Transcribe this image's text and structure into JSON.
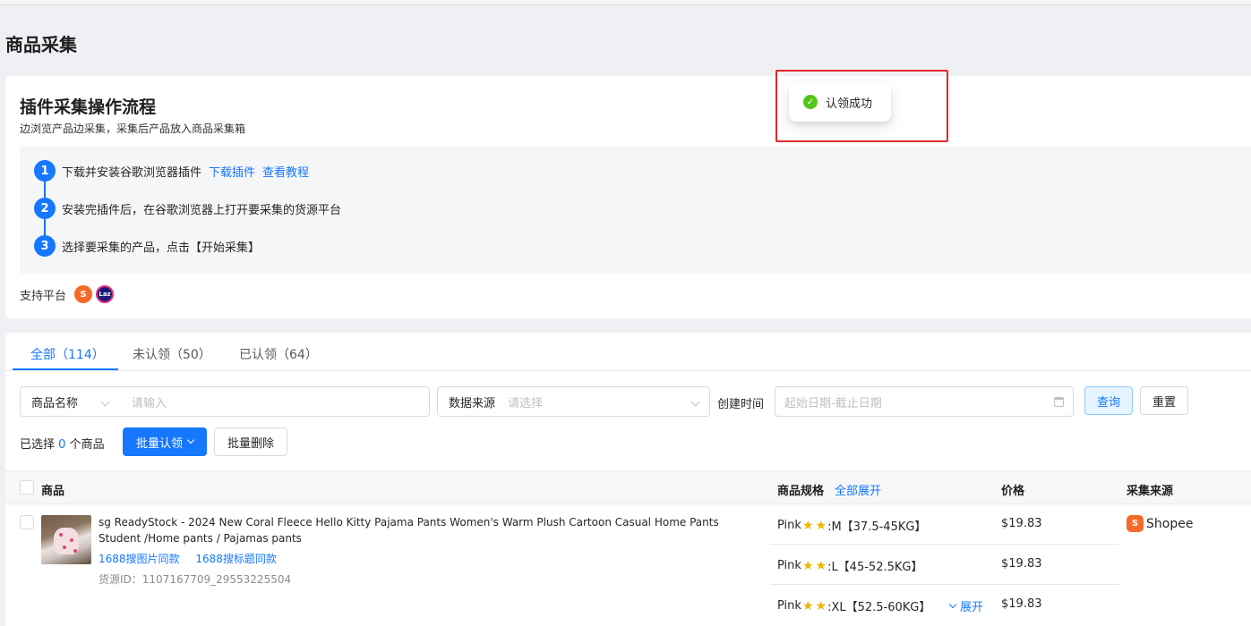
{
  "page": {
    "title": "商品采集"
  },
  "guide": {
    "title": "插件采集操作流程",
    "subtitle": "边浏览产品边采集，采集后产品放入商品采集箱",
    "steps": [
      {
        "num": "1",
        "text": "下载并安装谷歌浏览器插件",
        "links": [
          "下载插件",
          "查看教程"
        ]
      },
      {
        "num": "2",
        "text": "安装完插件后，在谷歌浏览器上打开要采集的货源平台"
      },
      {
        "num": "3",
        "text": "选择要采集的产品，点击【开始采集】"
      }
    ],
    "platforms_label": "支持平台",
    "platform_icons": [
      "shopee-icon",
      "lazada-icon"
    ],
    "lazada_mark": "Laz"
  },
  "tabs": [
    {
      "label": "全部（114）",
      "active": true
    },
    {
      "label": "未认领（50）",
      "active": false
    },
    {
      "label": "已认领（64）",
      "active": false
    }
  ],
  "filters": {
    "field_select": "商品名称",
    "keyword_placeholder": "请输入",
    "source_label": "数据来源",
    "source_placeholder": "请选择",
    "date_label": "创建时间",
    "date_placeholder": "起始日期-截止日期",
    "query_button": "查询",
    "reset_button": "重置"
  },
  "selection": {
    "prefix": "已选择",
    "count": "0",
    "suffix": "个商品",
    "batch_claim": "批量认领",
    "batch_delete": "批量删除"
  },
  "table": {
    "headers": {
      "product": "商品",
      "spec": "商品规格",
      "expand_all": "全部展开",
      "price": "价格",
      "source": "采集来源"
    },
    "rows": [
      {
        "title": "sg ReadyStock - 2024 New Coral Fleece Hello Kitty Pajama Pants Women's Warm Plush Cartoon Casual Home Pants Student /Home pants / Pajamas pants",
        "links": [
          "1688搜图片同款",
          "1688搜标题同款"
        ],
        "source_id": "货源ID：1107167709_29553225504",
        "source": "Shopee",
        "shopee_mark": "S",
        "specs": [
          {
            "prefix": "Pink",
            "suffix": ":M【37.5-45KG】",
            "price": "$19.83"
          },
          {
            "prefix": "Pink",
            "suffix": ":L【45-52.5KG】",
            "price": "$19.83"
          },
          {
            "prefix": "Pink",
            "suffix": ":XL【52.5-60KG】",
            "price": "$19.83"
          }
        ],
        "expand_label": "展开",
        "star_glyph": "★"
      }
    ]
  },
  "toast": {
    "text": "认领成功",
    "ok_glyph": "✓"
  },
  "colors": {
    "primary": "#1677ff",
    "success": "#52c41a",
    "highlight": "#e0282a",
    "shopee": "#f46a27"
  }
}
